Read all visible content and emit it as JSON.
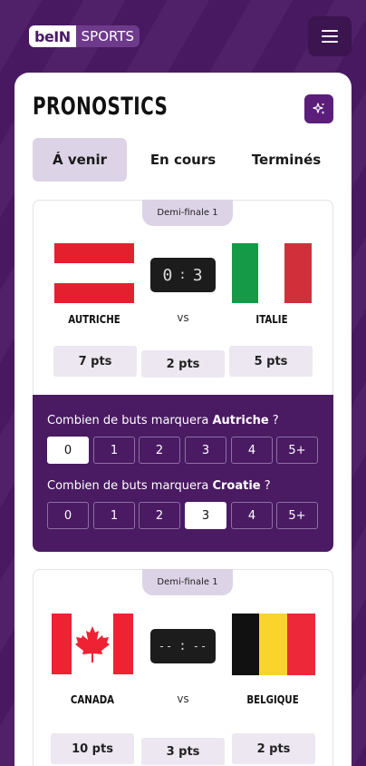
{
  "header": {
    "logo_bein": "beIN",
    "logo_sports": "SPORTS"
  },
  "page": {
    "title": "PRONOSTICS"
  },
  "tabs": [
    {
      "label": "Á venir",
      "active": true
    },
    {
      "label": "En cours",
      "active": false
    },
    {
      "label": "Terminés",
      "active": false
    }
  ],
  "matches": [
    {
      "round": "Demi-finale 1",
      "home": {
        "name": "AUTRICHE",
        "flag": "austria-flag"
      },
      "away": {
        "name": "ITALIE",
        "flag": "italy-flag"
      },
      "score": {
        "home": "0",
        "sep": ":",
        "away": "3"
      },
      "vs": "vs",
      "points": [
        "7 pts",
        "2 pts",
        "5 pts"
      ],
      "questions": [
        {
          "prefix": "Combien de buts marquera ",
          "team": "Autriche",
          "suffix": " ?",
          "options": [
            "0",
            "1",
            "2",
            "3",
            "4",
            "5+"
          ],
          "selected": "0"
        },
        {
          "prefix": "Combien de buts marquera ",
          "team": "Croatie",
          "suffix": " ?",
          "options": [
            "0",
            "1",
            "2",
            "3",
            "4",
            "5+"
          ],
          "selected": "3"
        }
      ]
    },
    {
      "round": "Demi-finale 1",
      "home": {
        "name": "CANADA",
        "flag": "canada-flag"
      },
      "away": {
        "name": "BELGIQUE",
        "flag": "belgium-flag"
      },
      "score": {
        "home": "--",
        "sep": ":",
        "away": "--"
      },
      "vs": "vs",
      "points": [
        "10 pts",
        "3 pts",
        "2 pts"
      ]
    }
  ],
  "colors": {
    "background": "#4a1a63",
    "accent": "#5b1e7a",
    "tab_active": "#ddd3e6"
  },
  "icons": {
    "menu": "hamburger-icon",
    "sparkle": "sparkle-icon"
  }
}
